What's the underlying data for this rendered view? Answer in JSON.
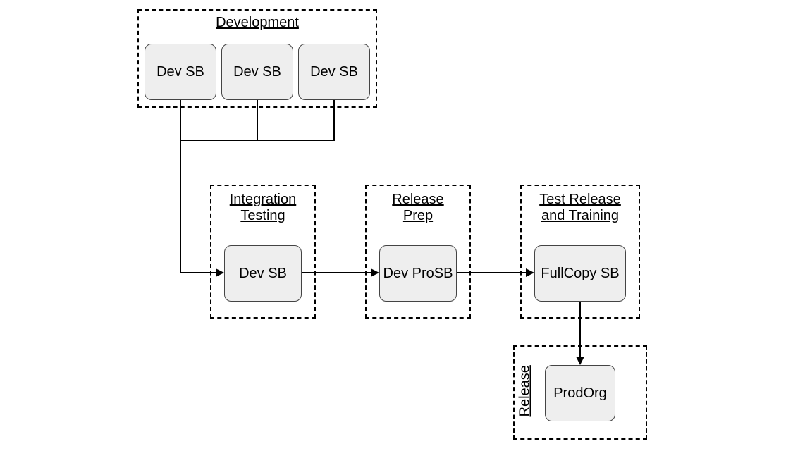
{
  "groups": {
    "development": {
      "title": "Development"
    },
    "integration": {
      "title_line1": "Integration",
      "title_line2": "Testing"
    },
    "release_prep": {
      "title_line1": "Release",
      "title_line2": "Prep"
    },
    "test_release": {
      "title_line1": "Test Release",
      "title_line2": "and Training"
    },
    "release": {
      "title": "Release"
    }
  },
  "nodes": {
    "dev1": "Dev SB",
    "dev2": "Dev SB",
    "dev3": "Dev SB",
    "integ": "Dev SB",
    "devpro_line1": "Dev Pro",
    "devpro_line2": "SB",
    "fullcopy_line1": "Full",
    "fullcopy_line2": "Copy SB",
    "prod_line1": "Prod",
    "prod_line2": "Org"
  }
}
